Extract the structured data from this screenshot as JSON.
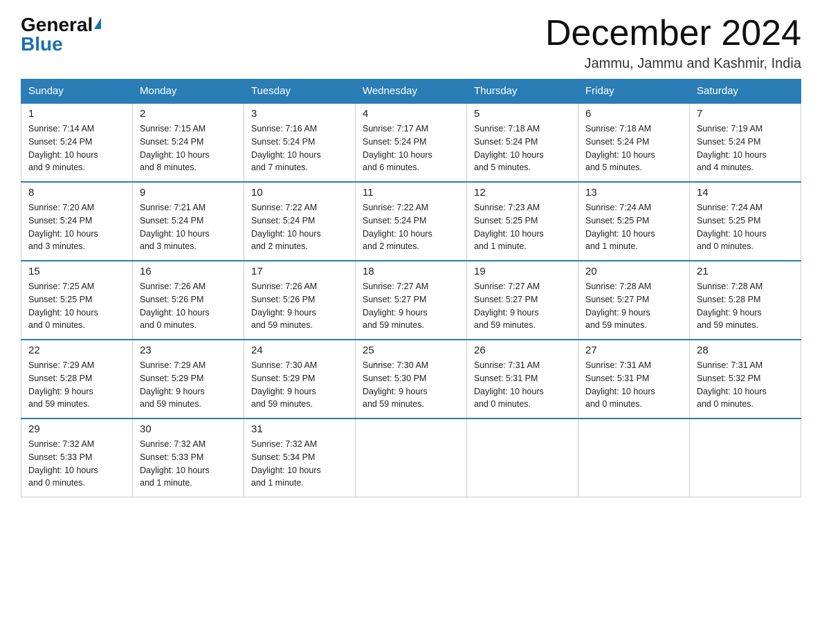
{
  "logo": {
    "general": "General",
    "blue": "Blue"
  },
  "title": "December 2024",
  "subtitle": "Jammu, Jammu and Kashmir, India",
  "headers": [
    "Sunday",
    "Monday",
    "Tuesday",
    "Wednesday",
    "Thursday",
    "Friday",
    "Saturday"
  ],
  "weeks": [
    [
      {
        "day": "1",
        "info": "Sunrise: 7:14 AM\nSunset: 5:24 PM\nDaylight: 10 hours\nand 9 minutes."
      },
      {
        "day": "2",
        "info": "Sunrise: 7:15 AM\nSunset: 5:24 PM\nDaylight: 10 hours\nand 8 minutes."
      },
      {
        "day": "3",
        "info": "Sunrise: 7:16 AM\nSunset: 5:24 PM\nDaylight: 10 hours\nand 7 minutes."
      },
      {
        "day": "4",
        "info": "Sunrise: 7:17 AM\nSunset: 5:24 PM\nDaylight: 10 hours\nand 6 minutes."
      },
      {
        "day": "5",
        "info": "Sunrise: 7:18 AM\nSunset: 5:24 PM\nDaylight: 10 hours\nand 5 minutes."
      },
      {
        "day": "6",
        "info": "Sunrise: 7:18 AM\nSunset: 5:24 PM\nDaylight: 10 hours\nand 5 minutes."
      },
      {
        "day": "7",
        "info": "Sunrise: 7:19 AM\nSunset: 5:24 PM\nDaylight: 10 hours\nand 4 minutes."
      }
    ],
    [
      {
        "day": "8",
        "info": "Sunrise: 7:20 AM\nSunset: 5:24 PM\nDaylight: 10 hours\nand 3 minutes."
      },
      {
        "day": "9",
        "info": "Sunrise: 7:21 AM\nSunset: 5:24 PM\nDaylight: 10 hours\nand 3 minutes."
      },
      {
        "day": "10",
        "info": "Sunrise: 7:22 AM\nSunset: 5:24 PM\nDaylight: 10 hours\nand 2 minutes."
      },
      {
        "day": "11",
        "info": "Sunrise: 7:22 AM\nSunset: 5:24 PM\nDaylight: 10 hours\nand 2 minutes."
      },
      {
        "day": "12",
        "info": "Sunrise: 7:23 AM\nSunset: 5:25 PM\nDaylight: 10 hours\nand 1 minute."
      },
      {
        "day": "13",
        "info": "Sunrise: 7:24 AM\nSunset: 5:25 PM\nDaylight: 10 hours\nand 1 minute."
      },
      {
        "day": "14",
        "info": "Sunrise: 7:24 AM\nSunset: 5:25 PM\nDaylight: 10 hours\nand 0 minutes."
      }
    ],
    [
      {
        "day": "15",
        "info": "Sunrise: 7:25 AM\nSunset: 5:25 PM\nDaylight: 10 hours\nand 0 minutes."
      },
      {
        "day": "16",
        "info": "Sunrise: 7:26 AM\nSunset: 5:26 PM\nDaylight: 10 hours\nand 0 minutes."
      },
      {
        "day": "17",
        "info": "Sunrise: 7:26 AM\nSunset: 5:26 PM\nDaylight: 9 hours\nand 59 minutes."
      },
      {
        "day": "18",
        "info": "Sunrise: 7:27 AM\nSunset: 5:27 PM\nDaylight: 9 hours\nand 59 minutes."
      },
      {
        "day": "19",
        "info": "Sunrise: 7:27 AM\nSunset: 5:27 PM\nDaylight: 9 hours\nand 59 minutes."
      },
      {
        "day": "20",
        "info": "Sunrise: 7:28 AM\nSunset: 5:27 PM\nDaylight: 9 hours\nand 59 minutes."
      },
      {
        "day": "21",
        "info": "Sunrise: 7:28 AM\nSunset: 5:28 PM\nDaylight: 9 hours\nand 59 minutes."
      }
    ],
    [
      {
        "day": "22",
        "info": "Sunrise: 7:29 AM\nSunset: 5:28 PM\nDaylight: 9 hours\nand 59 minutes."
      },
      {
        "day": "23",
        "info": "Sunrise: 7:29 AM\nSunset: 5:29 PM\nDaylight: 9 hours\nand 59 minutes."
      },
      {
        "day": "24",
        "info": "Sunrise: 7:30 AM\nSunset: 5:29 PM\nDaylight: 9 hours\nand 59 minutes."
      },
      {
        "day": "25",
        "info": "Sunrise: 7:30 AM\nSunset: 5:30 PM\nDaylight: 9 hours\nand 59 minutes."
      },
      {
        "day": "26",
        "info": "Sunrise: 7:31 AM\nSunset: 5:31 PM\nDaylight: 10 hours\nand 0 minutes."
      },
      {
        "day": "27",
        "info": "Sunrise: 7:31 AM\nSunset: 5:31 PM\nDaylight: 10 hours\nand 0 minutes."
      },
      {
        "day": "28",
        "info": "Sunrise: 7:31 AM\nSunset: 5:32 PM\nDaylight: 10 hours\nand 0 minutes."
      }
    ],
    [
      {
        "day": "29",
        "info": "Sunrise: 7:32 AM\nSunset: 5:33 PM\nDaylight: 10 hours\nand 0 minutes."
      },
      {
        "day": "30",
        "info": "Sunrise: 7:32 AM\nSunset: 5:33 PM\nDaylight: 10 hours\nand 1 minute."
      },
      {
        "day": "31",
        "info": "Sunrise: 7:32 AM\nSunset: 5:34 PM\nDaylight: 10 hours\nand 1 minute."
      },
      null,
      null,
      null,
      null
    ]
  ]
}
